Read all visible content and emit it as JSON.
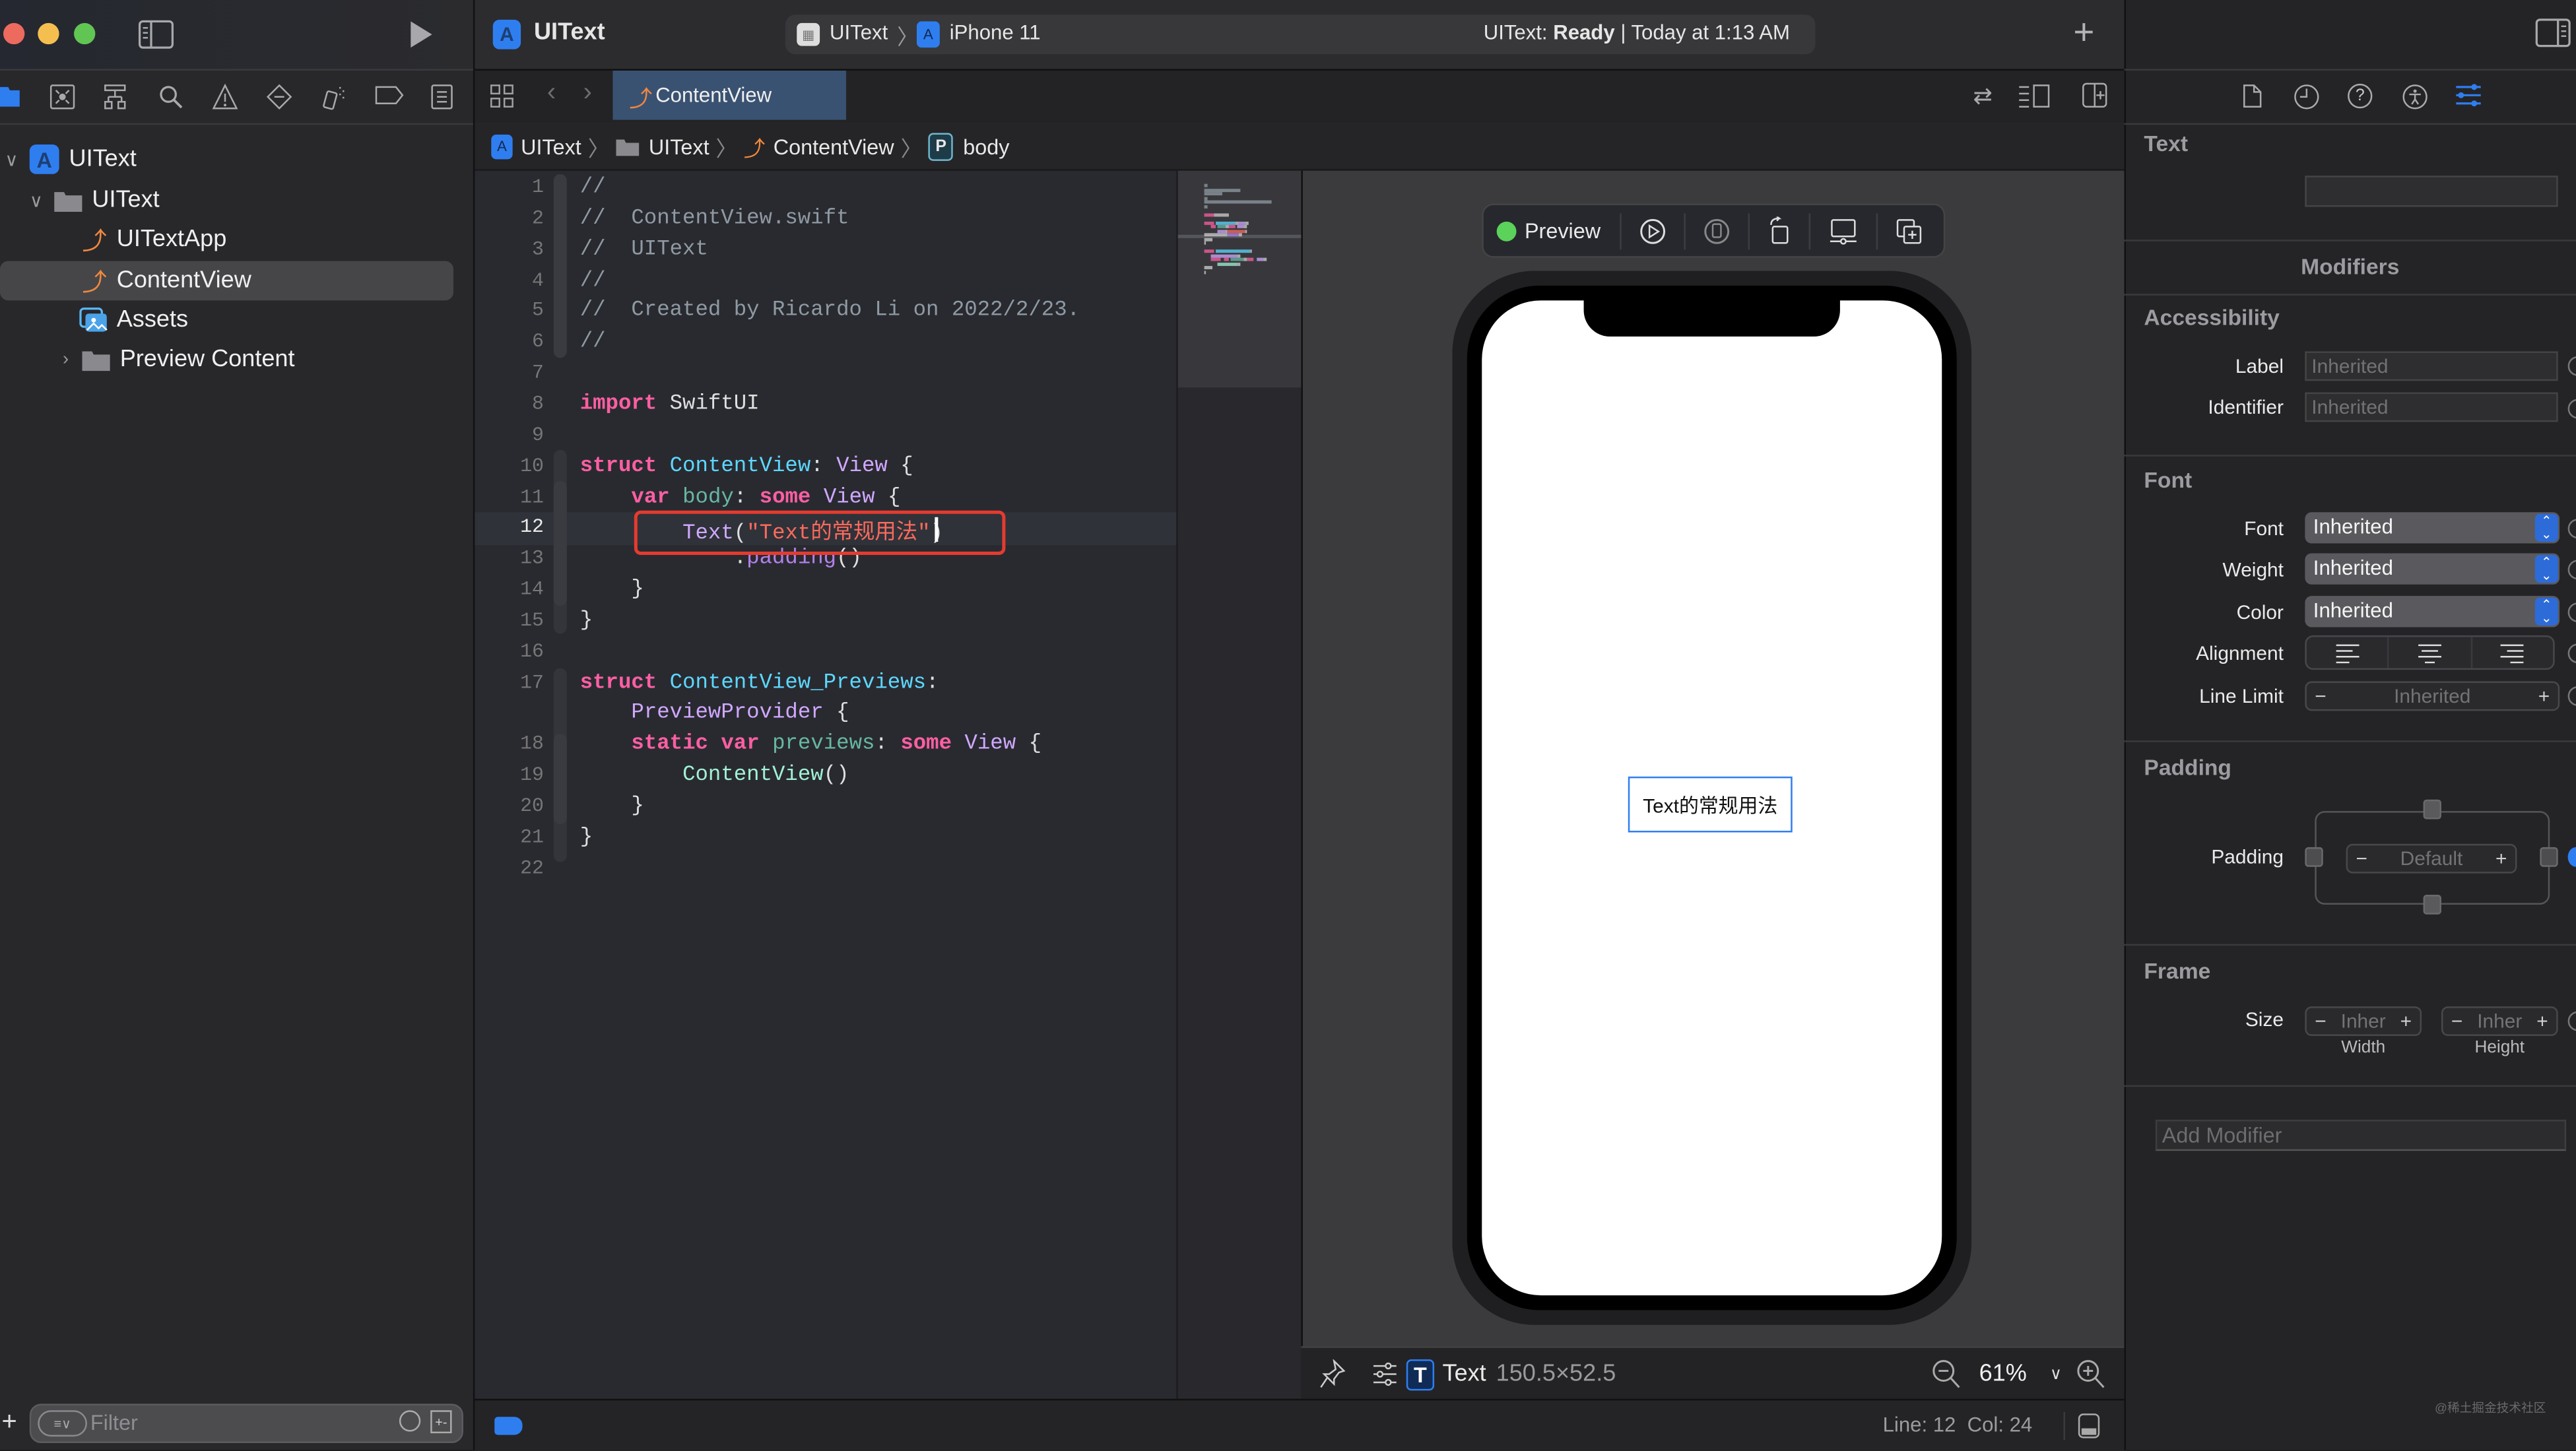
{
  "window": {
    "project_title": "UIText",
    "scheme": "UIText",
    "destination": "iPhone 11",
    "status_prefix": "UIText: ",
    "status_bold": "Ready",
    "status_time": "| Today at 1:13 AM"
  },
  "navigator": {
    "tree": [
      {
        "label": "UIText",
        "icon": "app-project-icon",
        "expanded": true
      },
      {
        "label": "UIText",
        "icon": "folder-icon",
        "expanded": true
      },
      {
        "label": "UITextApp",
        "icon": "swift-file-icon"
      },
      {
        "label": "ContentView",
        "icon": "swift-file-icon",
        "selected": true
      },
      {
        "label": "Assets",
        "icon": "asset-catalog-icon"
      },
      {
        "label": "Preview Content",
        "icon": "folder-icon",
        "expanded": false
      }
    ],
    "filter_placeholder": "Filter"
  },
  "editor": {
    "active_tab": "ContentView",
    "breadcrumb": [
      "UIText",
      "UIText",
      "ContentView",
      "body"
    ],
    "cursor_line": 12,
    "lines": [
      {
        "n": "1",
        "tokens": [
          {
            "t": "//",
            "c": "cm"
          }
        ]
      },
      {
        "n": "2",
        "tokens": [
          {
            "t": "//  ContentView.swift",
            "c": "cm"
          }
        ]
      },
      {
        "n": "3",
        "tokens": [
          {
            "t": "//  UIText",
            "c": "cm"
          }
        ]
      },
      {
        "n": "4",
        "tokens": [
          {
            "t": "//",
            "c": "cm"
          }
        ]
      },
      {
        "n": "5",
        "tokens": [
          {
            "t": "//  Created by Ricardo Li on 2022/2/23.",
            "c": "cm"
          }
        ]
      },
      {
        "n": "6",
        "tokens": [
          {
            "t": "//",
            "c": "cm"
          }
        ]
      },
      {
        "n": "7",
        "tokens": []
      },
      {
        "n": "8",
        "tokens": [
          {
            "t": "import",
            "c": "kw"
          },
          {
            "t": " SwiftUI",
            "c": ""
          }
        ]
      },
      {
        "n": "9",
        "tokens": []
      },
      {
        "n": "10",
        "tokens": [
          {
            "t": "struct",
            "c": "kw"
          },
          {
            "t": " ",
            "c": ""
          },
          {
            "t": "ContentView",
            "c": "ty"
          },
          {
            "t": ": ",
            "c": ""
          },
          {
            "t": "View",
            "c": "ty2"
          },
          {
            "t": " {",
            "c": ""
          }
        ]
      },
      {
        "n": "11",
        "tokens": [
          {
            "t": "    ",
            "c": ""
          },
          {
            "t": "var",
            "c": "kw"
          },
          {
            "t": " ",
            "c": ""
          },
          {
            "t": "body",
            "c": "fn"
          },
          {
            "t": ": ",
            "c": ""
          },
          {
            "t": "some",
            "c": "kw"
          },
          {
            "t": " ",
            "c": ""
          },
          {
            "t": "View",
            "c": "ty2"
          },
          {
            "t": " {",
            "c": ""
          }
        ]
      },
      {
        "n": "12",
        "tokens": [
          {
            "t": "        ",
            "c": ""
          },
          {
            "t": "Text",
            "c": "ty2"
          },
          {
            "t": "(",
            "c": ""
          },
          {
            "t": "\"Text的常规用法\"",
            "c": "str"
          },
          {
            "t": ")",
            "c": ""
          }
        ]
      },
      {
        "n": "13",
        "tokens": [
          {
            "t": "            .",
            "c": ""
          },
          {
            "t": "padding",
            "c": "mth"
          },
          {
            "t": "()",
            "c": ""
          }
        ]
      },
      {
        "n": "14",
        "tokens": [
          {
            "t": "    }",
            "c": ""
          }
        ]
      },
      {
        "n": "15",
        "tokens": [
          {
            "t": "}",
            "c": ""
          }
        ]
      },
      {
        "n": "16",
        "tokens": []
      },
      {
        "n": "17",
        "tokens": [
          {
            "t": "struct",
            "c": "kw"
          },
          {
            "t": " ",
            "c": ""
          },
          {
            "t": "ContentView_Previews",
            "c": "ty"
          },
          {
            "t": ":",
            "c": ""
          }
        ]
      },
      {
        "n": "",
        "tokens": [
          {
            "t": "    ",
            "c": ""
          },
          {
            "t": "PreviewProvider",
            "c": "ty2"
          },
          {
            "t": " {",
            "c": ""
          }
        ]
      },
      {
        "n": "18",
        "tokens": [
          {
            "t": "    ",
            "c": ""
          },
          {
            "t": "static",
            "c": "kw"
          },
          {
            "t": " ",
            "c": ""
          },
          {
            "t": "var",
            "c": "kw"
          },
          {
            "t": " ",
            "c": ""
          },
          {
            "t": "previews",
            "c": "fn"
          },
          {
            "t": ": ",
            "c": ""
          },
          {
            "t": "some",
            "c": "kw"
          },
          {
            "t": " ",
            "c": ""
          },
          {
            "t": "View",
            "c": "ty2"
          },
          {
            "t": " {",
            "c": ""
          }
        ]
      },
      {
        "n": "19",
        "tokens": [
          {
            "t": "        ",
            "c": ""
          },
          {
            "t": "ContentView",
            "c": "ctor"
          },
          {
            "t": "()",
            "c": ""
          }
        ]
      },
      {
        "n": "20",
        "tokens": [
          {
            "t": "    }",
            "c": ""
          }
        ]
      },
      {
        "n": "21",
        "tokens": [
          {
            "t": "}",
            "c": ""
          }
        ]
      },
      {
        "n": "22",
        "tokens": []
      }
    ]
  },
  "canvas": {
    "preview_label": "Preview",
    "preview_status_color": "#5bd25a",
    "rendered_text": "Text的常规用法",
    "selection_kind": "Text",
    "selection_size": "150.5×52.5",
    "zoom_level": "61%"
  },
  "statusbar": {
    "position": "Line: 12  Col: 24"
  },
  "inspector": {
    "text_section": "Text",
    "text_value": "",
    "modifiers_title": "Modifiers",
    "accessibility": {
      "title": "Accessibility",
      "label_label": "Label",
      "label_placeholder": "Inherited",
      "identifier_label": "Identifier",
      "identifier_placeholder": "Inherited"
    },
    "font": {
      "title": "Font",
      "font_label": "Font",
      "font_value": "Inherited",
      "weight_label": "Weight",
      "weight_value": "Inherited",
      "color_label": "Color",
      "color_value": "Inherited",
      "alignment_label": "Alignment",
      "line_limit_label": "Line Limit",
      "line_limit_value": "Inherited"
    },
    "padding": {
      "title": "Padding",
      "label": "Padding",
      "value": "Default"
    },
    "frame": {
      "title": "Frame",
      "size_label": "Size",
      "width_value": "Inher",
      "height_value": "Inher",
      "width_caption": "Width",
      "height_caption": "Height"
    },
    "add_modifier_placeholder": "Add Modifier"
  },
  "watermark": "@稀土掘金技术社区"
}
